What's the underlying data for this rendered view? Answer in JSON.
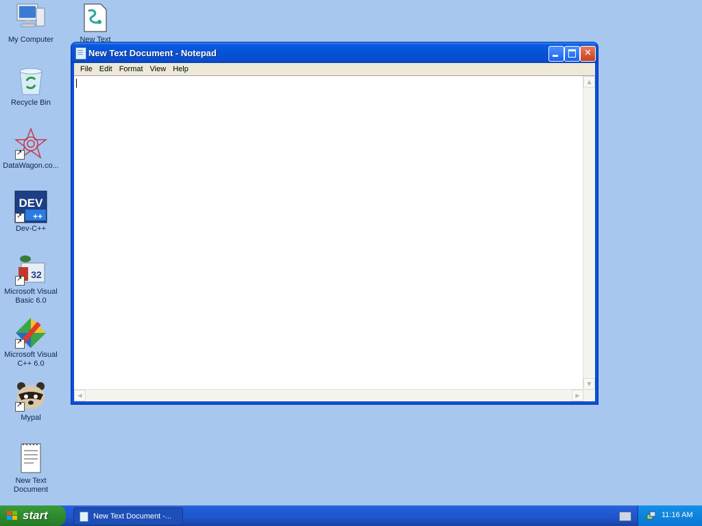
{
  "desktop": {
    "icons": [
      {
        "label": "My Computer"
      },
      {
        "label": "New Text"
      },
      {
        "label": "Recycle Bin"
      },
      {
        "label": "DataWagon.co..."
      },
      {
        "label": "Dev-C++"
      },
      {
        "label": "Microsoft Visual Basic 6.0"
      },
      {
        "label": "Microsoft Visual C++ 6.0"
      },
      {
        "label": "Mypal"
      },
      {
        "label": "New Text Document"
      }
    ],
    "devicon_text": "DEV",
    "vb_badge": "32"
  },
  "window": {
    "title": "New Text Document - Notepad",
    "menu": [
      "File",
      "Edit",
      "Format",
      "View",
      "Help"
    ],
    "content": ""
  },
  "taskbar": {
    "start_label": "start",
    "task_label": "New Text Document -...",
    "clock": "11:16 AM"
  },
  "colors": {
    "desktop": "#a7c7ee",
    "titlebar": "#0a58e0",
    "taskbar": "#245edb",
    "start": "#2f8a2f",
    "close": "#c8401d"
  }
}
